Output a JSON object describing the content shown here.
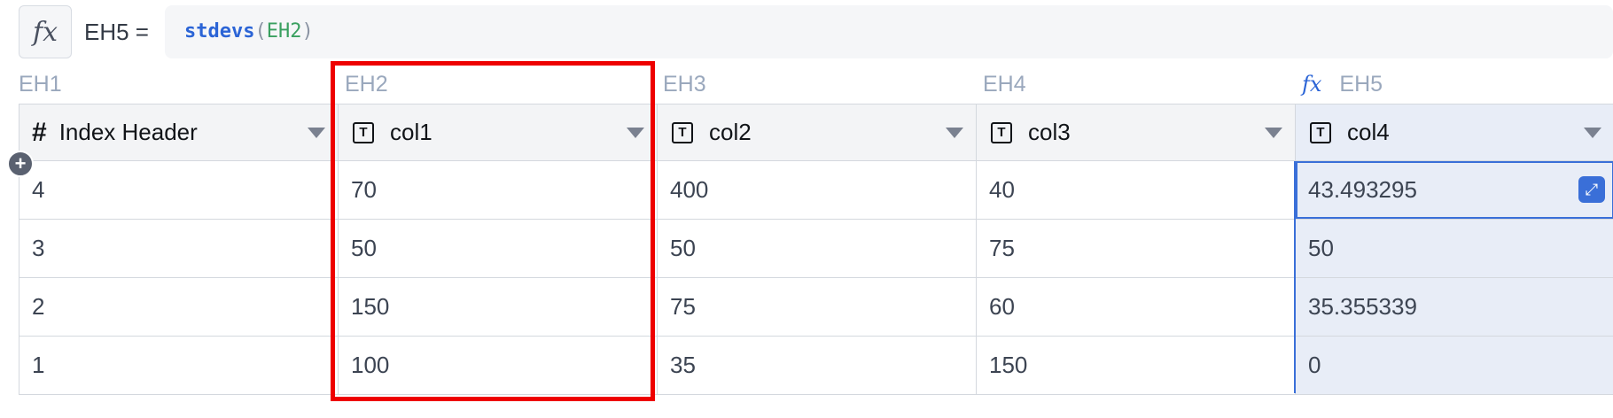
{
  "formula_bar": {
    "fx_icon": "fx",
    "cell_ref": "EH5 =",
    "function": "stdevs",
    "open_paren": "(",
    "argument": "EH2",
    "close_paren": ")"
  },
  "column_letters": [
    "EH1",
    "EH2",
    "EH3",
    "EH4",
    "EH5"
  ],
  "formula_column_icon": "fx",
  "columns": [
    {
      "icon": "#",
      "icon_name": "number-icon",
      "label": "Index Header"
    },
    {
      "icon": "T",
      "icon_name": "text-type-icon",
      "label": "col1"
    },
    {
      "icon": "T",
      "icon_name": "text-type-icon",
      "label": "col2"
    },
    {
      "icon": "T",
      "icon_name": "text-type-icon",
      "label": "col3"
    },
    {
      "icon": "T",
      "icon_name": "text-type-icon",
      "label": "col4"
    }
  ],
  "rows": [
    [
      "4",
      "70",
      "400",
      "40",
      "43.493295"
    ],
    [
      "3",
      "50",
      "50",
      "75",
      "50"
    ],
    [
      "2",
      "150",
      "75",
      "60",
      "35.355339"
    ],
    [
      "1",
      "100",
      "35",
      "150",
      "0"
    ]
  ],
  "add_row_icon": "+",
  "expand_icon": "⤢",
  "colors": {
    "accent": "#3a6fd8",
    "highlight": "#ee0000",
    "formula_function": "#2b64d6",
    "formula_argument": "#3aa060"
  }
}
